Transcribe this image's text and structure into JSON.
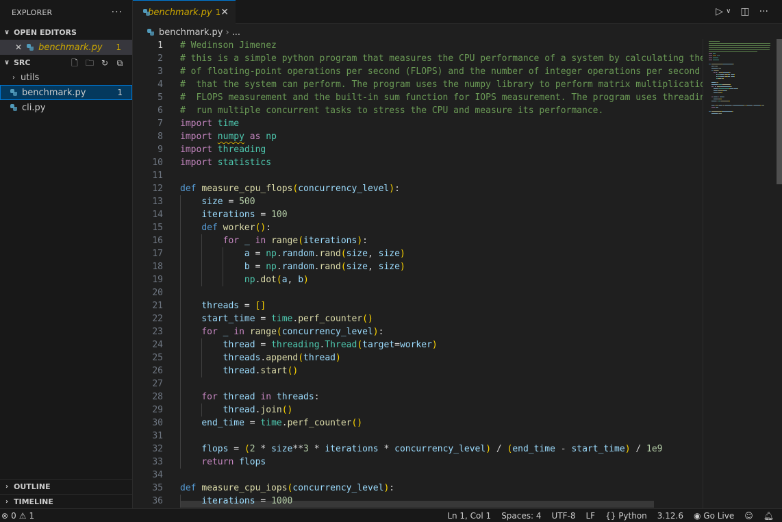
{
  "sidebar": {
    "header": "EXPLORER",
    "open_editors_title": "OPEN EDITORS",
    "open_editor": {
      "name": "benchmark.py",
      "count": "1"
    },
    "src_title": "SRC",
    "tree": [
      {
        "name": "utils",
        "kind": "folder"
      },
      {
        "name": "benchmark.py",
        "kind": "file",
        "count": "1",
        "selected": true
      },
      {
        "name": "cli.py",
        "kind": "file"
      }
    ],
    "outline_title": "OUTLINE",
    "timeline_title": "TIMELINE"
  },
  "tab": {
    "name": "benchmark.py",
    "modified": "1"
  },
  "breadcrumb": {
    "file": "benchmark.py",
    "more": "..."
  },
  "colors": {
    "accent": "#0078d4",
    "warning": "#cca700",
    "comment": "#6a9955",
    "keyword": "#c586c0"
  },
  "editor": {
    "lines": [
      [
        [
          "c-com",
          "# Wedinson Jimenez"
        ]
      ],
      [
        [
          "c-com",
          "# this is a simple python program that measures the CPU performance of a system by calculating the n"
        ]
      ],
      [
        [
          "c-com",
          "# of floating-point operations per second (FLOPS) and the number of integer operations per second (I"
        ]
      ],
      [
        [
          "c-com",
          "#  that the system can perform. The program uses the numpy library to perform matrix multiplication"
        ]
      ],
      [
        [
          "c-com",
          "#  FLOPS measurement and the built-in sum function for IOPS measurement. The program uses threading"
        ]
      ],
      [
        [
          "c-com",
          "#  run multiple concurrent tasks to stress the CPU and measure its performance."
        ]
      ],
      [
        [
          "c-kw",
          "import"
        ],
        [
          "c-op",
          " "
        ],
        [
          "c-mod",
          "time"
        ]
      ],
      [
        [
          "c-kw",
          "import"
        ],
        [
          "c-op",
          " "
        ],
        [
          "c-mod squig",
          "numpy"
        ],
        [
          "c-op",
          " "
        ],
        [
          "c-kw",
          "as"
        ],
        [
          "c-op",
          " "
        ],
        [
          "c-mod",
          "np"
        ]
      ],
      [
        [
          "c-kw",
          "import"
        ],
        [
          "c-op",
          " "
        ],
        [
          "c-mod",
          "threading"
        ]
      ],
      [
        [
          "c-kw",
          "import"
        ],
        [
          "c-op",
          " "
        ],
        [
          "c-mod",
          "statistics"
        ]
      ],
      [],
      [
        [
          "c-def",
          "def"
        ],
        [
          "c-op",
          " "
        ],
        [
          "c-fn",
          "measure_cpu_flops"
        ],
        [
          "c-p1",
          "("
        ],
        [
          "c-var",
          "concurrency_level"
        ],
        [
          "c-p1",
          ")"
        ],
        [
          "c-op",
          ":"
        ]
      ],
      [
        [
          "c-op",
          "    "
        ],
        [
          "c-var",
          "size"
        ],
        [
          "c-op",
          " = "
        ],
        [
          "c-num",
          "500"
        ]
      ],
      [
        [
          "c-op",
          "    "
        ],
        [
          "c-var",
          "iterations"
        ],
        [
          "c-op",
          " = "
        ],
        [
          "c-num",
          "100"
        ]
      ],
      [
        [
          "c-op",
          "    "
        ],
        [
          "c-def",
          "def"
        ],
        [
          "c-op",
          " "
        ],
        [
          "c-fn",
          "worker"
        ],
        [
          "c-p1",
          "()"
        ],
        [
          "c-op",
          ":"
        ]
      ],
      [
        [
          "c-op",
          "        "
        ],
        [
          "c-kw",
          "for"
        ],
        [
          "c-op",
          " "
        ],
        [
          "c-var",
          "_"
        ],
        [
          "c-op",
          " "
        ],
        [
          "c-kw",
          "in"
        ],
        [
          "c-op",
          " "
        ],
        [
          "c-fn",
          "range"
        ],
        [
          "c-p1",
          "("
        ],
        [
          "c-var",
          "iterations"
        ],
        [
          "c-p1",
          ")"
        ],
        [
          "c-op",
          ":"
        ]
      ],
      [
        [
          "c-op",
          "            "
        ],
        [
          "c-var",
          "a"
        ],
        [
          "c-op",
          " = "
        ],
        [
          "c-mod",
          "np"
        ],
        [
          "c-op",
          "."
        ],
        [
          "c-var",
          "random"
        ],
        [
          "c-op",
          "."
        ],
        [
          "c-fn",
          "rand"
        ],
        [
          "c-p1",
          "("
        ],
        [
          "c-var",
          "size"
        ],
        [
          "c-op",
          ", "
        ],
        [
          "c-var",
          "size"
        ],
        [
          "c-p1",
          ")"
        ]
      ],
      [
        [
          "c-op",
          "            "
        ],
        [
          "c-var",
          "b"
        ],
        [
          "c-op",
          " = "
        ],
        [
          "c-mod",
          "np"
        ],
        [
          "c-op",
          "."
        ],
        [
          "c-var",
          "random"
        ],
        [
          "c-op",
          "."
        ],
        [
          "c-fn",
          "rand"
        ],
        [
          "c-p1",
          "("
        ],
        [
          "c-var",
          "size"
        ],
        [
          "c-op",
          ", "
        ],
        [
          "c-var",
          "size"
        ],
        [
          "c-p1",
          ")"
        ]
      ],
      [
        [
          "c-op",
          "            "
        ],
        [
          "c-mod",
          "np"
        ],
        [
          "c-op",
          "."
        ],
        [
          "c-fn",
          "dot"
        ],
        [
          "c-p1",
          "("
        ],
        [
          "c-var",
          "a"
        ],
        [
          "c-op",
          ", "
        ],
        [
          "c-var",
          "b"
        ],
        [
          "c-p1",
          ")"
        ]
      ],
      [],
      [
        [
          "c-op",
          "    "
        ],
        [
          "c-var",
          "threads"
        ],
        [
          "c-op",
          " = "
        ],
        [
          "c-p1",
          "[]"
        ]
      ],
      [
        [
          "c-op",
          "    "
        ],
        [
          "c-var",
          "start_time"
        ],
        [
          "c-op",
          " = "
        ],
        [
          "c-mod",
          "time"
        ],
        [
          "c-op",
          "."
        ],
        [
          "c-fn",
          "perf_counter"
        ],
        [
          "c-p1",
          "()"
        ]
      ],
      [
        [
          "c-op",
          "    "
        ],
        [
          "c-kw",
          "for"
        ],
        [
          "c-op",
          " "
        ],
        [
          "c-var",
          "_"
        ],
        [
          "c-op",
          " "
        ],
        [
          "c-kw",
          "in"
        ],
        [
          "c-op",
          " "
        ],
        [
          "c-fn",
          "range"
        ],
        [
          "c-p1",
          "("
        ],
        [
          "c-var",
          "concurrency_level"
        ],
        [
          "c-p1",
          ")"
        ],
        [
          "c-op",
          ":"
        ]
      ],
      [
        [
          "c-op",
          "        "
        ],
        [
          "c-var",
          "thread"
        ],
        [
          "c-op",
          " = "
        ],
        [
          "c-mod",
          "threading"
        ],
        [
          "c-op",
          "."
        ],
        [
          "c-mod",
          "Thread"
        ],
        [
          "c-p1",
          "("
        ],
        [
          "c-var",
          "target"
        ],
        [
          "c-op",
          "="
        ],
        [
          "c-var",
          "worker"
        ],
        [
          "c-p1",
          ")"
        ]
      ],
      [
        [
          "c-op",
          "        "
        ],
        [
          "c-var",
          "threads"
        ],
        [
          "c-op",
          "."
        ],
        [
          "c-fn",
          "append"
        ],
        [
          "c-p1",
          "("
        ],
        [
          "c-var",
          "thread"
        ],
        [
          "c-p1",
          ")"
        ]
      ],
      [
        [
          "c-op",
          "        "
        ],
        [
          "c-var",
          "thread"
        ],
        [
          "c-op",
          "."
        ],
        [
          "c-fn",
          "start"
        ],
        [
          "c-p1",
          "()"
        ]
      ],
      [],
      [
        [
          "c-op",
          "    "
        ],
        [
          "c-kw",
          "for"
        ],
        [
          "c-op",
          " "
        ],
        [
          "c-var",
          "thread"
        ],
        [
          "c-op",
          " "
        ],
        [
          "c-kw",
          "in"
        ],
        [
          "c-op",
          " "
        ],
        [
          "c-var",
          "threads"
        ],
        [
          "c-op",
          ":"
        ]
      ],
      [
        [
          "c-op",
          "        "
        ],
        [
          "c-var",
          "thread"
        ],
        [
          "c-op",
          "."
        ],
        [
          "c-fn",
          "join"
        ],
        [
          "c-p1",
          "()"
        ]
      ],
      [
        [
          "c-op",
          "    "
        ],
        [
          "c-var",
          "end_time"
        ],
        [
          "c-op",
          " = "
        ],
        [
          "c-mod",
          "time"
        ],
        [
          "c-op",
          "."
        ],
        [
          "c-fn",
          "perf_counter"
        ],
        [
          "c-p1",
          "()"
        ]
      ],
      [],
      [
        [
          "c-op",
          "    "
        ],
        [
          "c-var",
          "flops"
        ],
        [
          "c-op",
          " = "
        ],
        [
          "c-p1",
          "("
        ],
        [
          "c-num",
          "2"
        ],
        [
          "c-op",
          " * "
        ],
        [
          "c-var",
          "size"
        ],
        [
          "c-op",
          "**"
        ],
        [
          "c-num",
          "3"
        ],
        [
          "c-op",
          " * "
        ],
        [
          "c-var",
          "iterations"
        ],
        [
          "c-op",
          " * "
        ],
        [
          "c-var",
          "concurrency_level"
        ],
        [
          "c-p1",
          ")"
        ],
        [
          "c-op",
          " / "
        ],
        [
          "c-p1",
          "("
        ],
        [
          "c-var",
          "end_time"
        ],
        [
          "c-op",
          " - "
        ],
        [
          "c-var",
          "start_time"
        ],
        [
          "c-p1",
          ")"
        ],
        [
          "c-op",
          " / "
        ],
        [
          "c-num",
          "1e9"
        ]
      ],
      [
        [
          "c-op",
          "    "
        ],
        [
          "c-kw",
          "return"
        ],
        [
          "c-op",
          " "
        ],
        [
          "c-var",
          "flops"
        ]
      ],
      [],
      [
        [
          "c-def",
          "def"
        ],
        [
          "c-op",
          " "
        ],
        [
          "c-fn",
          "measure_cpu_iops"
        ],
        [
          "c-p1",
          "("
        ],
        [
          "c-var",
          "concurrency_level"
        ],
        [
          "c-p1",
          ")"
        ],
        [
          "c-op",
          ":"
        ]
      ],
      [
        [
          "c-op",
          "    "
        ],
        [
          "c-var",
          "iterations"
        ],
        [
          "c-op",
          " = "
        ],
        [
          "c-num",
          "1000"
        ]
      ]
    ]
  },
  "status": {
    "errors": "0",
    "warnings": "1",
    "position": "Ln 1, Col 1",
    "spaces": "Spaces: 4",
    "encoding": "UTF-8",
    "eol": "LF",
    "language": "Python",
    "version": "3.12.6",
    "golive": "Go Live"
  }
}
